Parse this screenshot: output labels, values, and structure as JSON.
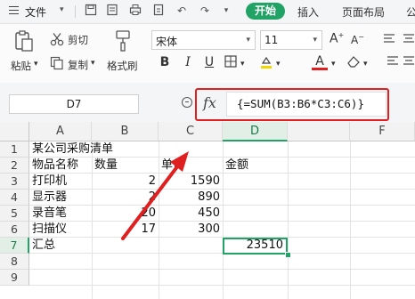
{
  "menubar": {
    "file_label": "文件",
    "tabs": [
      "开始",
      "插入",
      "页面布局",
      "公"
    ]
  },
  "ribbon": {
    "paste_label": "粘贴",
    "cut_label": "剪切",
    "copy_label": "复制",
    "format_painter_label": "格式刷",
    "font_name": "宋体",
    "font_size": "11",
    "bold": "B",
    "italic": "I",
    "underline": "U",
    "font_color_glyph": "A"
  },
  "formula_bar": {
    "name_box": "D7",
    "fx_label": "fx",
    "formula": "{=SUM(B3:B6*C3:C6)}"
  },
  "sheet": {
    "columns": [
      "A",
      "B",
      "C",
      "D",
      "F"
    ],
    "rows": [
      "1",
      "2",
      "3",
      "4",
      "5",
      "6",
      "7",
      "8",
      "9"
    ],
    "title": "某公司采购清单",
    "headers": {
      "name": "物品名称",
      "qty": "数量",
      "price": "单价",
      "amount": "金额"
    },
    "items": [
      {
        "name": "打印机",
        "qty": "2",
        "price": "1590"
      },
      {
        "name": "显示器",
        "qty": "2",
        "price": "890"
      },
      {
        "name": "录音笔",
        "qty": "20",
        "price": "450"
      },
      {
        "name": "扫描仪",
        "qty": "17",
        "price": "300"
      }
    ],
    "total_label": "汇总",
    "total_value": "23510",
    "selected_cell": "D7"
  },
  "colors": {
    "accent": "#21a366",
    "annotation": "#e02020"
  }
}
